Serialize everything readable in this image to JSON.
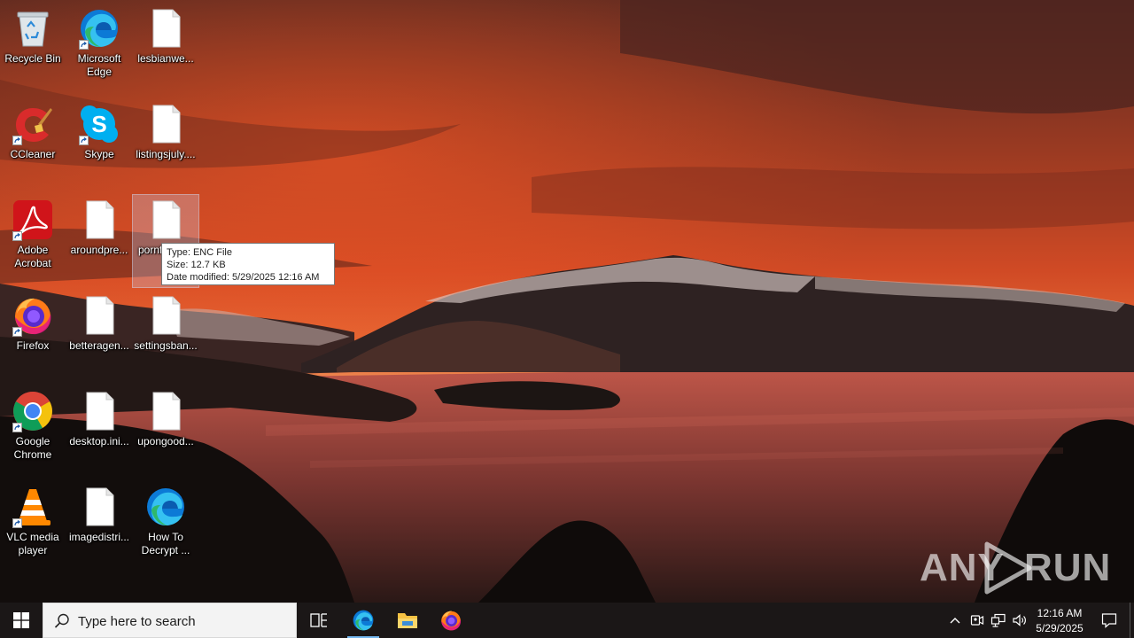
{
  "desktop": {
    "icons": [
      {
        "label": "Recycle Bin",
        "icon": "recycle-bin-icon",
        "shortcut": false
      },
      {
        "label": "Microsoft Edge",
        "icon": "edge-icon",
        "shortcut": true
      },
      {
        "label": "lesbianwe...",
        "icon": "file-icon",
        "shortcut": false
      },
      {
        "label": "CCleaner",
        "icon": "ccleaner-icon",
        "shortcut": true
      },
      {
        "label": "Skype",
        "icon": "skype-icon",
        "shortcut": true
      },
      {
        "label": "listingsjuly....",
        "icon": "file-icon",
        "shortcut": false
      },
      {
        "label": "Adobe Acrobat",
        "icon": "acrobat-icon",
        "shortcut": true
      },
      {
        "label": "aroundpre...",
        "icon": "file-icon",
        "shortcut": false
      },
      {
        "label": "pornf... .E...",
        "icon": "file-icon",
        "shortcut": false,
        "selected": true
      },
      {
        "label": "Firefox",
        "icon": "firefox-icon",
        "shortcut": true
      },
      {
        "label": "betteragen...",
        "icon": "file-icon",
        "shortcut": false
      },
      {
        "label": "settingsban...",
        "icon": "file-icon",
        "shortcut": false
      },
      {
        "label": "Google Chrome",
        "icon": "chrome-icon",
        "shortcut": true
      },
      {
        "label": "desktop.ini...",
        "icon": "file-icon",
        "shortcut": false
      },
      {
        "label": "upongood...",
        "icon": "file-icon",
        "shortcut": false
      },
      {
        "label": "VLC media player",
        "icon": "vlc-icon",
        "shortcut": true
      },
      {
        "label": "imagedistri...",
        "icon": "file-icon",
        "shortcut": false
      },
      {
        "label": "How To Decrypt ...",
        "icon": "edge-icon",
        "shortcut": false
      }
    ]
  },
  "tooltip": {
    "type": "Type: ENC File",
    "size": "Size: 12.7 KB",
    "modified": "Date modified: 5/29/2025 12:16 AM"
  },
  "watermark": {
    "left": "ANY",
    "right": "RUN"
  },
  "taskbar": {
    "search_placeholder": "Type here to search",
    "pinned": [
      "edge-icon",
      "file-explorer-icon",
      "firefox-icon"
    ],
    "clock": {
      "time": "12:16 AM",
      "date": "5/29/2025"
    }
  },
  "colors": {
    "taskbar": "#1b1717",
    "sky_top": "#5a2418",
    "sky_glow": "#e0532a",
    "water": "#b04a3a"
  }
}
